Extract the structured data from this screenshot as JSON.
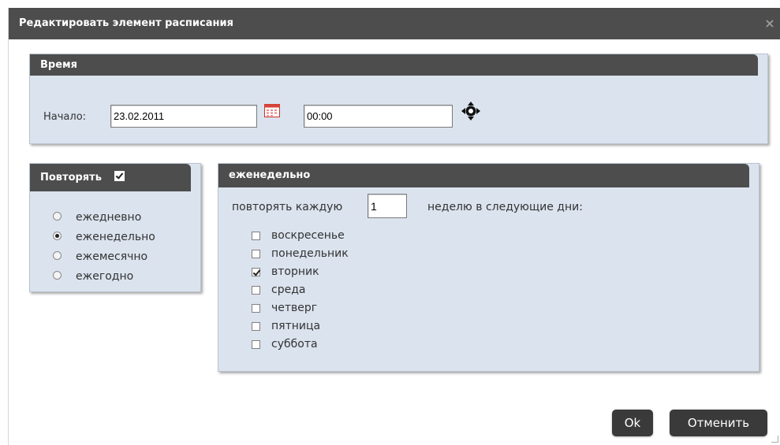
{
  "dialog": {
    "title": "Редактировать элемент расписания",
    "close_label": "×"
  },
  "time_section": {
    "header": "Время",
    "start_label": "Начало:",
    "date_value": "23.02.2011",
    "time_value": "00:00",
    "icons": [
      "calendar-icon",
      "move-icon"
    ]
  },
  "repeat_section": {
    "header": "Повторять",
    "checked": true,
    "options": [
      {
        "label": "ежедневно",
        "selected": false
      },
      {
        "label": "еженедельно",
        "selected": true
      },
      {
        "label": "ежемесячно",
        "selected": false
      },
      {
        "label": "ежегодно",
        "selected": false
      }
    ]
  },
  "weekly_section": {
    "header": "еженедельно",
    "repeat_every_label": "повторять каждую",
    "repeat_every_value": "1",
    "weeks_label": "неделю в следующие дни:",
    "days": [
      {
        "label": "воскресенье",
        "checked": false
      },
      {
        "label": "понедельник",
        "checked": false
      },
      {
        "label": "вторник",
        "checked": true
      },
      {
        "label": "среда",
        "checked": false
      },
      {
        "label": "четверг",
        "checked": false
      },
      {
        "label": "пятница",
        "checked": false
      },
      {
        "label": "суббота",
        "checked": false
      }
    ]
  },
  "buttons": {
    "ok_label": "Ok",
    "cancel_label": "Отменить"
  },
  "colors": {
    "titlebar": "#4d4d4d",
    "panel_bg": "#dbe3ee",
    "button_bg": "#3a3a3a"
  }
}
